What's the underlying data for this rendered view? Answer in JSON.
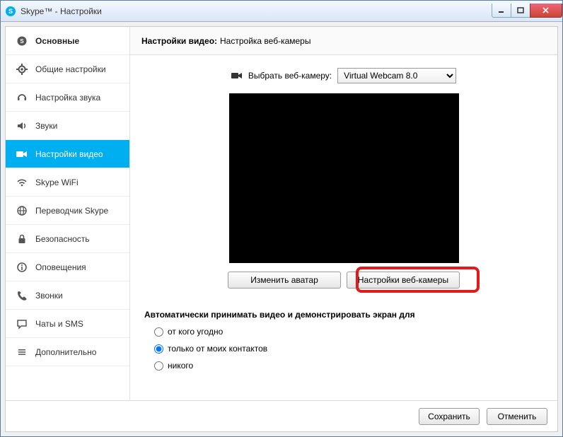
{
  "window": {
    "title": "Skype™ - Настройки"
  },
  "sidebar": {
    "items": [
      {
        "label": "Основные",
        "icon": "skype"
      },
      {
        "label": "Общие настройки",
        "icon": "gear"
      },
      {
        "label": "Настройка звука",
        "icon": "headset"
      },
      {
        "label": "Звуки",
        "icon": "speaker"
      },
      {
        "label": "Настройки видео",
        "icon": "camera"
      },
      {
        "label": "Skype WiFi",
        "icon": "wifi"
      },
      {
        "label": "Переводчик Skype",
        "icon": "globe"
      },
      {
        "label": "Безопасность",
        "icon": "lock"
      },
      {
        "label": "Оповещения",
        "icon": "info"
      },
      {
        "label": "Звонки",
        "icon": "phone"
      },
      {
        "label": "Чаты и SMS",
        "icon": "chat"
      },
      {
        "label": "Дополнительно",
        "icon": "dots"
      }
    ],
    "activeIndex": 4
  },
  "main": {
    "headerBold": "Настройки видео:",
    "headerRest": "Настройка веб-камеры",
    "selectLabel": "Выбрать веб-камеру:",
    "selectValue": "Virtual Webcam 8.0",
    "buttons": {
      "changeAvatar": "Изменить аватар",
      "webcamSettings": "Настройки веб-камеры"
    },
    "autoSection": {
      "title": "Автоматически принимать видео и демонстрировать экран для",
      "options": [
        "от кого угодно",
        "только от моих контактов",
        "никого"
      ],
      "selected": 1
    }
  },
  "footer": {
    "save": "Сохранить",
    "cancel": "Отменить"
  }
}
